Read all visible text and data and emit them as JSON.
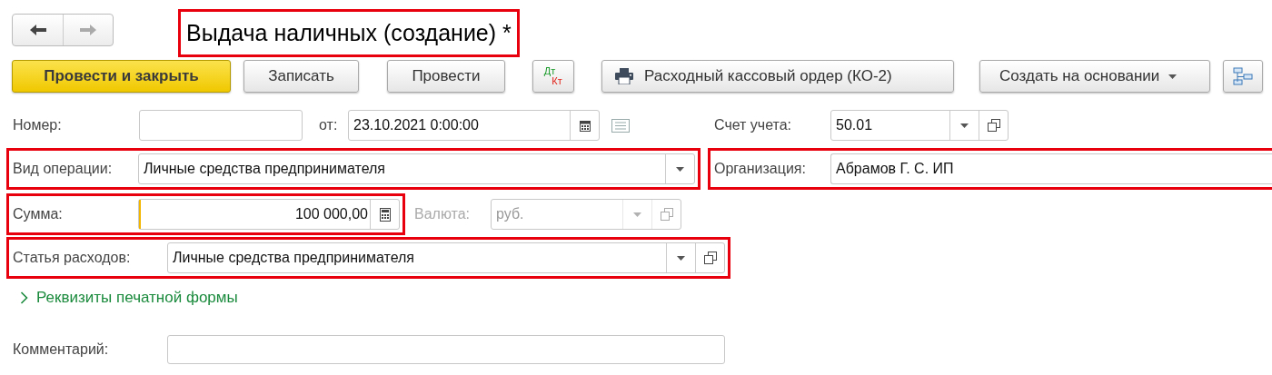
{
  "nav": [
    {
      "kind": "back",
      "disabled": false
    },
    {
      "kind": "forward",
      "disabled": true
    }
  ],
  "title": {
    "text": "Выдача наличных (создание) *",
    "highlighted": true
  },
  "toolbar": [
    {
      "kind": "primary",
      "label": "Провести и закрыть"
    },
    {
      "kind": "plain",
      "label": "Записать"
    },
    {
      "kind": "plain",
      "label": "Провести"
    },
    {
      "kind": "dtkt",
      "label_top": "Дт",
      "label_bottom": "Кт"
    },
    {
      "kind": "print",
      "label": "Расходный кассовый ордер (КО-2)"
    },
    {
      "kind": "menu",
      "label": "Создать на основании"
    },
    {
      "kind": "structure"
    }
  ],
  "rows": [
    [
      {
        "kind": "text",
        "label": "Номер:",
        "disabled": false
      },
      {
        "kind": "date",
        "label": "от:",
        "value": "23.10.2021  0:00:00",
        "disabled": false
      },
      {
        "kind": "select",
        "label": "Счет учета:",
        "value": "50.01",
        "open_button": true,
        "disabled": false
      }
    ],
    [
      {
        "kind": "select",
        "label": "Вид операции:",
        "value": "Личные средства предпринимателя",
        "open_button": false,
        "highlighted": true,
        "disabled": false
      },
      {
        "kind": "text",
        "label": "Организация:",
        "value": "Абрамов Г. С. ИП",
        "highlighted": true,
        "disabled": false
      }
    ],
    [
      {
        "kind": "number",
        "label": "Сумма:",
        "value": "100 000,00",
        "highlighted": true,
        "disabled": false
      },
      {
        "kind": "select",
        "label": "Валюта:",
        "value": "руб.",
        "open_button": true,
        "disabled": true
      }
    ],
    [
      {
        "kind": "select",
        "label": "Статья расходов:",
        "value": "Личные средства предпринимателя",
        "open_button": true,
        "highlighted": true,
        "disabled": false
      }
    ]
  ],
  "print_form_link": {
    "text": "Реквизиты печатной формы",
    "expanded": false
  },
  "comment": {
    "label": "Комментарий:",
    "disabled": false
  }
}
